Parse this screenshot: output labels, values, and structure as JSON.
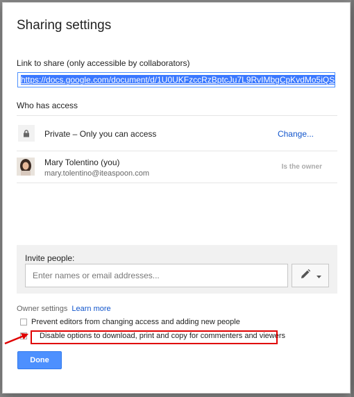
{
  "dialog": {
    "title": "Sharing settings",
    "link_label": "Link to share (only accessible by collaborators)",
    "link_url": "https://docs.google.com/document/d/1U0UKFzccRzBptcJu7L9RvIMbgCpKvdMo5iQS",
    "who_has_access": "Who has access",
    "access": {
      "description": "Private – Only you can access",
      "change_label": "Change..."
    },
    "user": {
      "name": "Mary Tolentino (you)",
      "email": "mary.tolentino@iteaspoon.com",
      "role": "Is the owner"
    },
    "invite": {
      "label": "Invite people:",
      "placeholder": "Enter names or email addresses..."
    },
    "owner_settings": {
      "label": "Owner settings",
      "learn_more": "Learn more",
      "option_prevent": "Prevent editors from changing access and adding new people",
      "option_disable": "Disable options to download, print and copy for commenters and viewers"
    },
    "done_label": "Done"
  },
  "colors": {
    "primary_button": "#4d90fe",
    "link": "#1155cc",
    "highlight": "#e00000"
  }
}
